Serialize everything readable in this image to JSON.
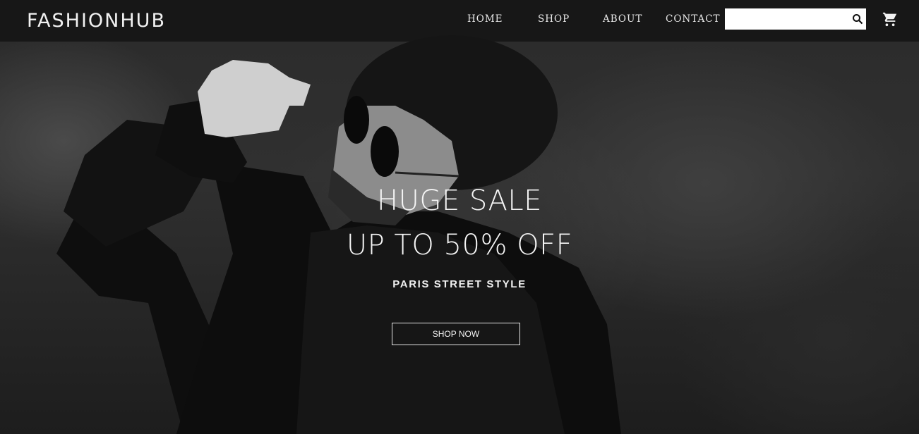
{
  "header": {
    "brand": "FASHIONHUB",
    "nav": {
      "home": "HOME",
      "shop": "SHOP",
      "about": "ABOUT",
      "contact": "CONTACT"
    },
    "search": {
      "value": "",
      "placeholder": ""
    }
  },
  "hero": {
    "title_line1": "HUGE SALE",
    "title_line2": "UP TO 50% OFF",
    "subtitle": "PARIS STREET STYLE",
    "cta_label": "SHOP NOW"
  },
  "icons": {
    "search": "search-icon",
    "cart": "shopping-cart-icon"
  },
  "colors": {
    "header_bg": "#161616",
    "text": "#f5f5f5",
    "search_bg": "#ffffff"
  }
}
